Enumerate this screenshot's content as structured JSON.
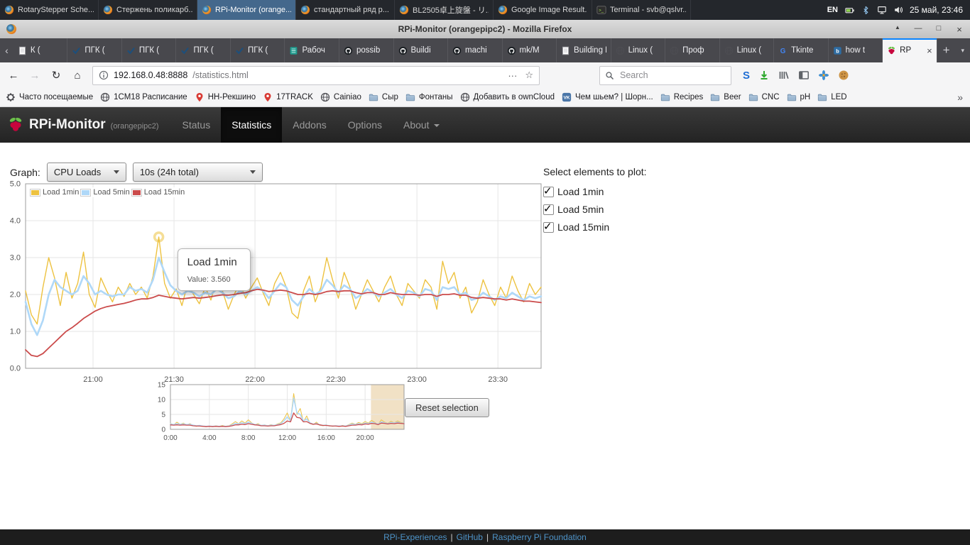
{
  "glyphs": {
    "tab_scroll_left": "‹",
    "tab_close": "×",
    "new_tab": "+",
    "all_tabs": "▾",
    "back": "←",
    "forward": "→",
    "reload": "↻",
    "home": "⌂",
    "ellipsis": "···",
    "star": "☆",
    "overflow": "»",
    "window_shade": "▲",
    "window_minimize": "—",
    "window_maximize": "□",
    "window_close": "×"
  },
  "desktop": {
    "taskbar": {
      "windows": [
        {
          "title": "RotaryStepper Sche...",
          "icon": "firefox-icon",
          "active": false
        },
        {
          "title": "Стержень поликарб...",
          "icon": "firefox-icon",
          "active": false
        },
        {
          "title": "RPi-Monitor (orange...",
          "icon": "firefox-icon",
          "active": true
        },
        {
          "title": "стандартный ряд р...",
          "icon": "firefox-icon",
          "active": false
        },
        {
          "title": "BL2505卓上旋盤 - リ...",
          "icon": "firefox-icon",
          "active": false
        },
        {
          "title": "Google Image Result...",
          "icon": "firefox-icon",
          "active": false
        },
        {
          "title": "Terminal - svb@qslvr...",
          "icon": "terminal-icon",
          "active": false
        }
      ],
      "tray": {
        "keyboard_layout": "EN",
        "icons": [
          "battery-icon",
          "bluetooth-icon",
          "network-icon",
          "volume-icon"
        ],
        "clock": "25 май, 23:46"
      }
    }
  },
  "window": {
    "title": "RPi-Monitor (orangepipc2) - Mozilla Firefox"
  },
  "browser": {
    "tab_bar": {
      "tabs": [
        {
          "label": "К (",
          "icon": "page-icon",
          "active": false
        },
        {
          "label": "ПГК (",
          "icon": "check-icon",
          "active": false
        },
        {
          "label": "ПГК (",
          "icon": "check-icon",
          "active": false
        },
        {
          "label": "ПГК (",
          "icon": "check-icon",
          "active": false
        },
        {
          "label": "ПГК (",
          "icon": "check-icon",
          "active": false
        },
        {
          "label": "Рабоч",
          "icon": "sheet-icon",
          "active": false
        },
        {
          "label": "possib",
          "icon": "github-icon",
          "active": false
        },
        {
          "label": "Buildi",
          "icon": "github-icon",
          "active": false
        },
        {
          "label": "machi",
          "icon": "github-icon",
          "active": false
        },
        {
          "label": "mk/M",
          "icon": "github-icon",
          "active": false
        },
        {
          "label": "Building L",
          "icon": "page-icon",
          "active": false
        },
        {
          "label": "Linux (",
          "icon": "globe-icon",
          "active": false
        },
        {
          "label": "Проф",
          "icon": "globe-icon",
          "active": false
        },
        {
          "label": "Linux (",
          "icon": "globe-icon",
          "active": false
        },
        {
          "label": "Tkinte",
          "icon": "google-icon",
          "active": false
        },
        {
          "label": "how t",
          "icon": "blue-site-icon",
          "active": false
        },
        {
          "label": "RP",
          "icon": "raspberry-icon",
          "active": true
        }
      ]
    },
    "toolbar": {
      "url_host": "192.168.0.48:8888",
      "url_path": "/statistics.html",
      "search_placeholder": "Search",
      "session_label": "S"
    },
    "bookmarks": {
      "items": [
        {
          "label": "Часто посещаемые",
          "icon": "gear-icon"
        },
        {
          "label": "1СМ18 Расписание",
          "icon": "globe-icon"
        },
        {
          "label": "НН-Рекшино",
          "icon": "pin-icon"
        },
        {
          "label": "17TRACK",
          "icon": "pin-icon"
        },
        {
          "label": "Cainiao",
          "icon": "globe-icon"
        },
        {
          "label": "Сыр",
          "icon": "folder-icon"
        },
        {
          "label": "Фонтаны",
          "icon": "folder-icon"
        },
        {
          "label": "Добавить в ownCloud",
          "icon": "globe-icon"
        },
        {
          "label": "Чем шьем? | Шорн...",
          "icon": "vk-icon"
        },
        {
          "label": "Recipes",
          "icon": "folder-icon"
        },
        {
          "label": "Beer",
          "icon": "folder-icon"
        },
        {
          "label": "CNC",
          "icon": "folder-icon"
        },
        {
          "label": "pH",
          "icon": "folder-icon"
        },
        {
          "label": "LED",
          "icon": "folder-icon"
        }
      ]
    }
  },
  "page": {
    "navbar": {
      "brand": "RPi-Monitor",
      "brand_suffix": "(orangepipc2)",
      "items": [
        {
          "label": "Status",
          "active": false
        },
        {
          "label": "Statistics",
          "active": true
        },
        {
          "label": "Addons",
          "active": false
        },
        {
          "label": "Options",
          "active": false
        },
        {
          "label": "About",
          "active": false,
          "caret": true
        }
      ]
    },
    "controls": {
      "graph_label": "Graph:",
      "graph_select": "CPU Loads",
      "interval_select": "10s (24h total)"
    },
    "plot_panel": {
      "title": "Select elements to plot:",
      "items": [
        {
          "label": "Load 1min",
          "checked": true
        },
        {
          "label": "Load 5min",
          "checked": true
        },
        {
          "label": "Load 15min",
          "checked": true
        }
      ]
    },
    "tooltip": {
      "title": "Load 1min",
      "value": "Value: 3.560"
    },
    "overview": {
      "reset_button": "Reset selection"
    },
    "footer": {
      "links": [
        "RPi-Experiences",
        "GitHub",
        "Raspberry Pi Foundation"
      ],
      "separator": "|"
    }
  },
  "chart_data": [
    {
      "type": "line",
      "legend_position": "top-left",
      "grid": true,
      "x_unit": "minutes since 20:35",
      "xlim": [
        0,
        191
      ],
      "ylim": [
        0,
        5
      ],
      "xticks": [
        {
          "v": 25,
          "label": "21:00"
        },
        {
          "v": 55,
          "label": "21:30"
        },
        {
          "v": 85,
          "label": "22:00"
        },
        {
          "v": 115,
          "label": "22:30"
        },
        {
          "v": 145,
          "label": "23:00"
        },
        {
          "v": 175,
          "label": "23:30"
        }
      ],
      "yticks": [
        {
          "v": 0,
          "label": "0.0"
        },
        {
          "v": 1,
          "label": "1.0"
        },
        {
          "v": 2,
          "label": "2.0"
        },
        {
          "v": 3,
          "label": "3.0"
        },
        {
          "v": 4,
          "label": "4.0"
        },
        {
          "v": 5,
          "label": "5.0"
        }
      ],
      "highlight": {
        "series": 0,
        "index": 23,
        "value": 3.56
      },
      "series": [
        {
          "name": "Load 1min",
          "color": "#edc240",
          "width": 1.4,
          "x0": 0,
          "dx": 2.146,
          "values": [
            2.1,
            1.45,
            1.2,
            2.2,
            3.0,
            2.45,
            1.7,
            2.6,
            1.9,
            2.3,
            3.15,
            2.0,
            1.65,
            2.45,
            2.1,
            1.8,
            2.2,
            1.95,
            2.3,
            2.0,
            2.2,
            1.9,
            2.5,
            3.56,
            2.3,
            1.9,
            2.15,
            1.7,
            2.3,
            2.0,
            1.75,
            2.2,
            1.85,
            2.4,
            2.1,
            1.6,
            2.0,
            2.3,
            1.9,
            2.2,
            2.45,
            2.05,
            1.7,
            2.3,
            2.6,
            2.2,
            1.5,
            1.35,
            2.1,
            2.5,
            1.8,
            2.2,
            3.0,
            2.4,
            1.9,
            2.6,
            2.2,
            1.6,
            2.0,
            2.4,
            2.1,
            1.8,
            2.2,
            2.5,
            2.0,
            1.7,
            2.3,
            2.1,
            1.9,
            2.4,
            2.2,
            1.6,
            2.9,
            2.3,
            2.6,
            1.9,
            2.2,
            1.5,
            1.8,
            2.4,
            2.0,
            1.7,
            2.2,
            1.9,
            2.5,
            2.1,
            1.8,
            2.3,
            2.0,
            2.2
          ]
        },
        {
          "name": "Load 5min",
          "color": "#afd8f8",
          "width": 2.6,
          "x0": 0,
          "dx": 2.146,
          "values": [
            1.8,
            1.2,
            0.9,
            1.3,
            2.0,
            2.4,
            2.2,
            2.1,
            2.0,
            2.1,
            2.5,
            2.3,
            2.0,
            2.1,
            2.0,
            1.95,
            2.0,
            2.0,
            2.2,
            2.1,
            2.15,
            2.05,
            2.4,
            3.0,
            2.6,
            2.25,
            2.1,
            2.0,
            2.1,
            2.05,
            1.95,
            2.05,
            2.0,
            2.15,
            2.05,
            1.9,
            1.95,
            2.1,
            2.0,
            2.1,
            2.2,
            2.1,
            1.9,
            2.1,
            2.3,
            2.2,
            1.85,
            1.7,
            1.95,
            2.15,
            2.0,
            2.1,
            2.4,
            2.25,
            2.05,
            2.25,
            2.15,
            1.9,
            2.0,
            2.15,
            2.05,
            1.95,
            2.05,
            2.15,
            2.0,
            1.9,
            2.1,
            2.05,
            1.95,
            2.15,
            2.1,
            1.85,
            2.2,
            2.15,
            2.2,
            2.0,
            2.05,
            1.85,
            1.9,
            2.05,
            1.95,
            1.85,
            1.95,
            1.9,
            2.05,
            1.95,
            1.85,
            1.95,
            1.9,
            1.95
          ]
        },
        {
          "name": "Load 15min",
          "color": "#cb4b4b",
          "width": 1.8,
          "x0": 0,
          "dx": 2.146,
          "values": [
            0.5,
            0.35,
            0.32,
            0.4,
            0.55,
            0.7,
            0.85,
            1.0,
            1.1,
            1.22,
            1.35,
            1.45,
            1.55,
            1.62,
            1.67,
            1.7,
            1.73,
            1.76,
            1.8,
            1.85,
            1.88,
            1.88,
            1.92,
            1.98,
            1.95,
            1.92,
            1.9,
            1.88,
            1.9,
            1.92,
            1.9,
            1.92,
            1.94,
            1.97,
            1.99,
            1.98,
            2.0,
            2.03,
            2.05,
            2.1,
            2.14,
            2.12,
            2.08,
            2.1,
            2.12,
            2.1,
            2.05,
            2.0,
            2.0,
            2.03,
            2.0,
            2.03,
            2.08,
            2.1,
            2.08,
            2.1,
            2.1,
            2.05,
            2.02,
            2.05,
            2.05,
            2.0,
            2.0,
            2.05,
            2.02,
            2.0,
            2.0,
            2.0,
            1.98,
            2.0,
            2.0,
            1.95,
            2.0,
            2.0,
            2.02,
            1.98,
            1.98,
            1.92,
            1.9,
            1.92,
            1.9,
            1.88,
            1.88,
            1.85,
            1.88,
            1.85,
            1.82,
            1.82,
            1.8,
            1.78
          ]
        }
      ]
    },
    {
      "type": "line",
      "grid": true,
      "x_unit": "hours (24h overview)",
      "xlim": [
        0,
        24
      ],
      "ylim": [
        0,
        15
      ],
      "selection": [
        20.6,
        24
      ],
      "xticks": [
        {
          "v": 0,
          "label": "0:00"
        },
        {
          "v": 4,
          "label": "4:00"
        },
        {
          "v": 8,
          "label": "8:00"
        },
        {
          "v": 12,
          "label": "12:00"
        },
        {
          "v": 16,
          "label": "16:00"
        },
        {
          "v": 20,
          "label": "20:00"
        }
      ],
      "yticks": [
        {
          "v": 0,
          "label": "0"
        },
        {
          "v": 5,
          "label": "5"
        },
        {
          "v": 10,
          "label": "10"
        },
        {
          "v": 15,
          "label": "15"
        }
      ],
      "series": [
        {
          "name": "Load 1min",
          "color": "#edc240",
          "width": 1,
          "x0": 0,
          "dx": 0.33333,
          "values": [
            2.0,
            1.5,
            2.4,
            1.7,
            2.1,
            1.5,
            1.9,
            1.3,
            1.0,
            1.3,
            1.0,
            0.9,
            1.1,
            0.9,
            1.2,
            1.0,
            1.3,
            1.0,
            1.2,
            1.8,
            2.6,
            1.9,
            2.8,
            2.1,
            3.2,
            2.2,
            1.6,
            1.9,
            1.3,
            1.5,
            1.2,
            1.6,
            1.3,
            1.8,
            2.2,
            3.5,
            5.5,
            3.0,
            12.0,
            5.0,
            7.0,
            2.5,
            4.5,
            2.0,
            1.6,
            2.4,
            1.4,
            1.2,
            1.5,
            1.1,
            1.0,
            1.2,
            1.0,
            1.3,
            1.1,
            1.6,
            2.1,
            1.7,
            2.3,
            1.9,
            2.6,
            2.1,
            3.0,
            2.3,
            1.6,
            3.2,
            2.4,
            2.0,
            2.7,
            2.2,
            2.8,
            2.3,
            2.1
          ]
        },
        {
          "name": "Load 5min",
          "color": "#afd8f8",
          "width": 1.6,
          "x0": 0,
          "dx": 0.33333,
          "values": [
            1.8,
            1.6,
            1.9,
            1.7,
            1.8,
            1.6,
            1.7,
            1.4,
            1.2,
            1.3,
            1.1,
            1.0,
            1.1,
            1.0,
            1.1,
            1.0,
            1.1,
            1.0,
            1.1,
            1.5,
            2.0,
            1.8,
            2.2,
            1.9,
            2.4,
            2.0,
            1.6,
            1.6,
            1.3,
            1.4,
            1.2,
            1.4,
            1.3,
            1.6,
            1.9,
            2.8,
            4.2,
            2.8,
            10.5,
            5.5,
            5.0,
            2.8,
            3.5,
            2.2,
            1.7,
            2.0,
            1.5,
            1.3,
            1.4,
            1.2,
            1.1,
            1.2,
            1.1,
            1.2,
            1.1,
            1.4,
            1.8,
            1.6,
            1.9,
            1.7,
            2.1,
            1.9,
            2.4,
            2.1,
            1.7,
            2.5,
            2.2,
            1.9,
            2.3,
            2.1,
            2.4,
            2.1,
            2.0
          ]
        },
        {
          "name": "Load 15min",
          "color": "#cb4b4b",
          "width": 1.3,
          "x0": 0,
          "dx": 0.33333,
          "values": [
            1.5,
            1.4,
            1.5,
            1.4,
            1.5,
            1.4,
            1.4,
            1.2,
            1.1,
            1.1,
            1.0,
            0.9,
            1.0,
            0.9,
            1.0,
            0.9,
            1.0,
            0.9,
            1.0,
            1.2,
            1.5,
            1.5,
            1.7,
            1.6,
            1.9,
            1.7,
            1.5,
            1.4,
            1.2,
            1.2,
            1.1,
            1.2,
            1.2,
            1.4,
            1.6,
            2.0,
            2.8,
            2.5,
            5.5,
            4.0,
            3.8,
            2.5,
            2.6,
            2.0,
            1.7,
            1.8,
            1.5,
            1.3,
            1.3,
            1.2,
            1.1,
            1.1,
            1.0,
            1.1,
            1.0,
            1.2,
            1.4,
            1.4,
            1.6,
            1.5,
            1.8,
            1.7,
            2.0,
            1.9,
            1.6,
            2.1,
            2.0,
            1.8,
            2.0,
            1.9,
            2.1,
            2.0,
            1.9
          ]
        }
      ]
    }
  ]
}
